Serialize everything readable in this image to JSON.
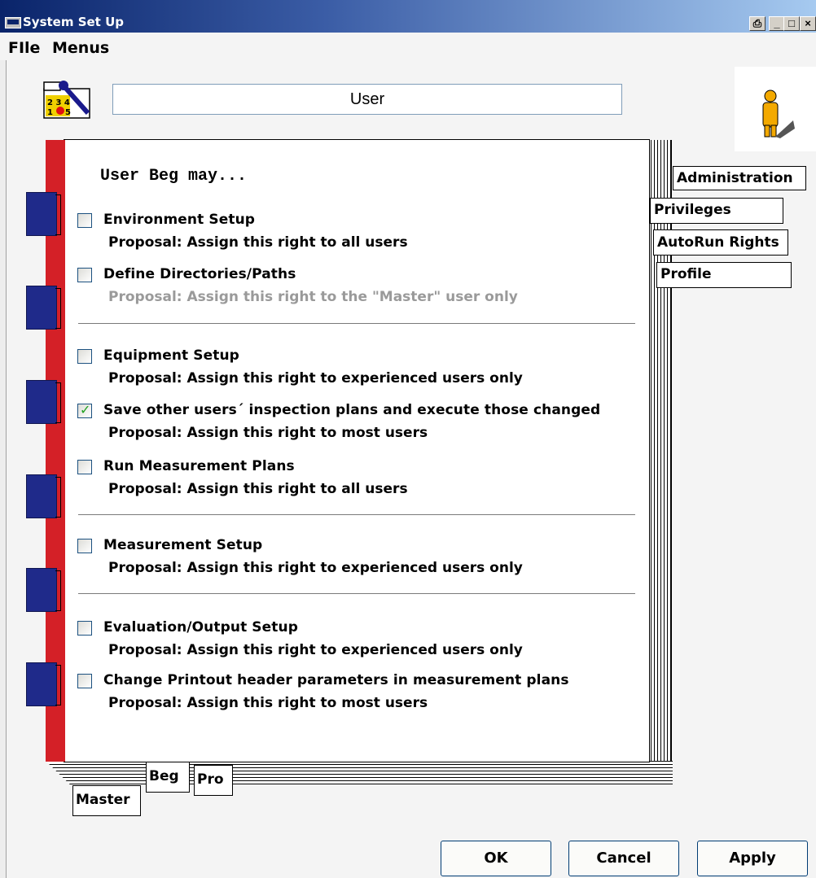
{
  "window": {
    "title": "System Set Up"
  },
  "menu": {
    "file": "FIle",
    "menus": "Menus"
  },
  "user_field": {
    "value": "User"
  },
  "page": {
    "heading": "User Beg may...",
    "items": [
      {
        "label": "Environment Setup",
        "proposal": "Proposal: Assign this right to all users",
        "checked": false
      },
      {
        "label": "Define Directories/Paths",
        "proposal": "Proposal: Assign this right to the \"Master\" user only",
        "checked": false,
        "disabled": true
      },
      {
        "label": "Equipment Setup",
        "proposal": "Proposal: Assign this right to experienced users only",
        "checked": false
      },
      {
        "label": "Save other users´ inspection plans and execute those changed",
        "proposal": "Proposal: Assign this right to most users",
        "checked": true
      },
      {
        "label": "Run Measurement Plans",
        "proposal": "Proposal: Assign this right to all users",
        "checked": false
      },
      {
        "label": "Measurement Setup",
        "proposal": "Proposal: Assign this right to experienced users only",
        "checked": false
      },
      {
        "label": "Evaluation/Output Setup",
        "proposal": "Proposal: Assign this right to experienced users only",
        "checked": false
      },
      {
        "label": "Change Printout header parameters in measurement plans",
        "proposal": "Proposal: Assign this right to most users",
        "checked": false
      }
    ]
  },
  "side_tabs": [
    "Administration",
    "Privileges",
    "AutoRun Rights",
    "Profile"
  ],
  "bottom_tabs": [
    "Master",
    "Beg",
    "Pro"
  ],
  "buttons": {
    "ok": "OK",
    "cancel": "Cancel",
    "apply": "Apply"
  },
  "colors": {
    "binder_red": "#d42027",
    "binder_tab_blue": "#1f2a8a",
    "titlebar": "#0a246a"
  },
  "icons": {
    "app": "window-icon",
    "tool": "tool-settings-icon",
    "user": "person-icon"
  }
}
